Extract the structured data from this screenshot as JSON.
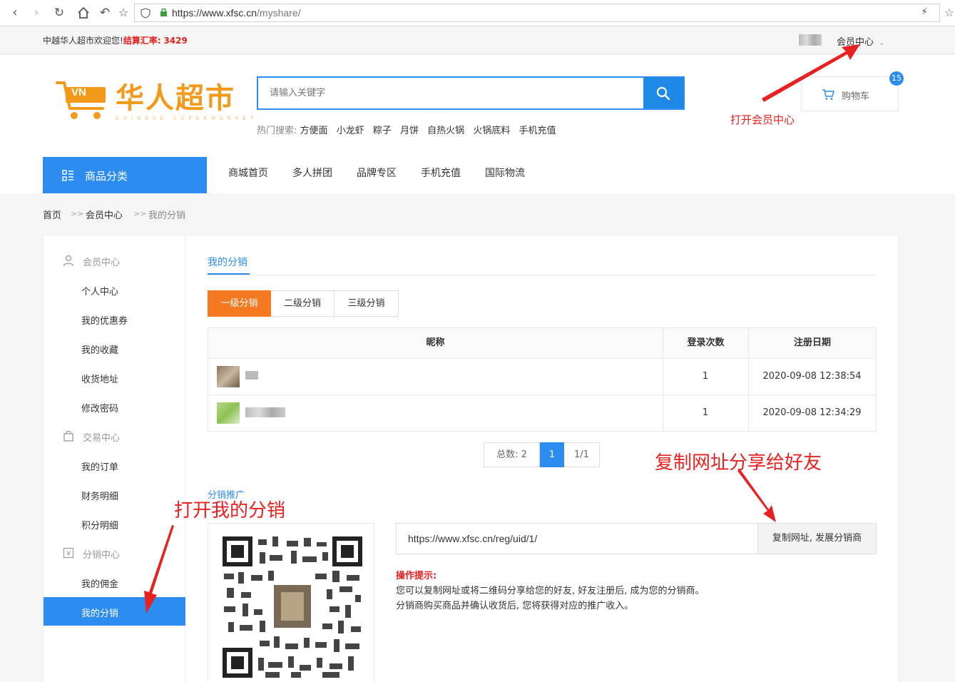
{
  "browser": {
    "url_host": "https://www.xfsc.cn",
    "url_path": "/myshare/"
  },
  "topbar": {
    "welcome": "中越华人超市欢迎您!",
    "rate_label": "结算汇率:",
    "rate_value": "3429",
    "member_center": "会员中心"
  },
  "header": {
    "logo_text": "华人超市",
    "logo_sub": "CHINESE SUPERMARKET",
    "logo_badge": "VN",
    "search_placeholder": "请输入关键字",
    "hot_label": "热门搜索:",
    "hot_keywords": [
      "方便面",
      "小龙虾",
      "粽子",
      "月饼",
      "自热火锅",
      "火锅底料",
      "手机充值"
    ],
    "cart_label": "购物车",
    "cart_count": "15"
  },
  "nav": {
    "category_btn": "商品分类",
    "items": [
      "商城首页",
      "多人拼团",
      "品牌专区",
      "手机充值",
      "国际物流"
    ]
  },
  "breadcrumb": [
    "首页",
    "会员中心",
    "我的分销"
  ],
  "breadcrumb_sep": ">>",
  "sidebar": {
    "groups": [
      {
        "title": "会员中心",
        "items": [
          "个人中心",
          "我的优惠券",
          "我的收藏",
          "收货地址",
          "修改密码"
        ]
      },
      {
        "title": "交易中心",
        "items": [
          "我的订单",
          "财务明细",
          "积分明细"
        ]
      },
      {
        "title": "分销中心",
        "items": [
          "我的佣金",
          "我的分销"
        ]
      }
    ]
  },
  "content": {
    "title": "我的分销",
    "tabs": [
      "一级分销",
      "二级分销",
      "三级分销"
    ],
    "table": {
      "headers": [
        "昵称",
        "登录次数",
        "注册日期"
      ],
      "rows": [
        {
          "logins": "1",
          "date": "2020-09-08 12:38:54"
        },
        {
          "logins": "1",
          "date": "2020-09-08 12:34:29"
        }
      ]
    },
    "pager": {
      "total": "总数: 2",
      "current": "1",
      "pages": "1/1"
    },
    "promo_title": "分销推广",
    "share_url": "https://www.xfsc.cn/reg/uid/1/",
    "copy_btn": "复制网址, 发展分销商",
    "tip_title": "操作提示:",
    "tip_lines": [
      "您可以复制网址或将二维码分享给您的好友, 好友注册后, 成为您的分销商。",
      "分销商购买商品并确认收货后, 您将获得对应的推广收入。"
    ]
  },
  "annotations": {
    "open_member": "打开会员中心",
    "copy_share": "复制网址分享给好友",
    "open_share": "打开我的分销"
  },
  "colors": {
    "primary": "#2d8cf0",
    "orange": "#f47920",
    "annotation": "#e82020"
  }
}
